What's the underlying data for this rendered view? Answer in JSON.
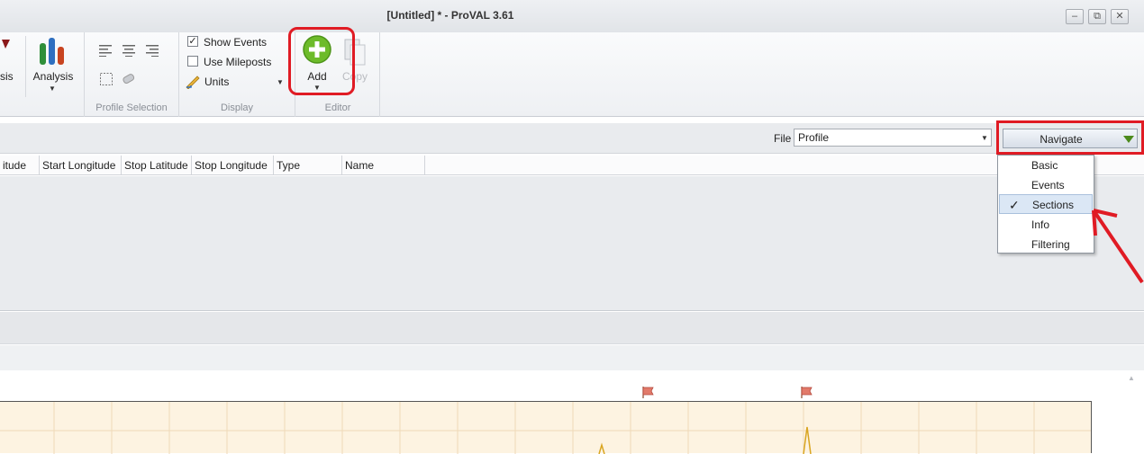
{
  "window": {
    "title": "[Untitled] * - ProVAL 3.61",
    "minimize": "–",
    "restore": "⧉",
    "close": "✕"
  },
  "ribbon": {
    "partial_label": "sis",
    "analysis_label": "Analysis",
    "profile_selection_label": "Profile Selection",
    "display": {
      "show_events": "Show Events",
      "show_events_checked": true,
      "use_mileposts": "Use Mileposts",
      "use_mileposts_checked": false,
      "units": "Units",
      "group_label": "Display"
    },
    "editor": {
      "add": "Add",
      "copy": "Copy",
      "group_label": "Editor"
    }
  },
  "navbar": {
    "file_label": "File",
    "file_value": "Profile",
    "navigate_label": "Navigate"
  },
  "table": {
    "columns": [
      "itude",
      "Start Longitude",
      "Stop Latitude",
      "Stop Longitude",
      "Type",
      "Name"
    ]
  },
  "menu": {
    "items": [
      {
        "label": "Basic",
        "checked": false
      },
      {
        "label": "Events",
        "checked": false
      },
      {
        "label": "Sections",
        "checked": true
      },
      {
        "label": "Info",
        "checked": false
      },
      {
        "label": "Filtering",
        "checked": false
      }
    ],
    "check_mark": "✓"
  },
  "colors": {
    "highlight": "#e01b24",
    "add_green": "#6dbb2a",
    "navigate_arrow": "#4c8a1c",
    "plot_fill": "#fdf3e1"
  }
}
